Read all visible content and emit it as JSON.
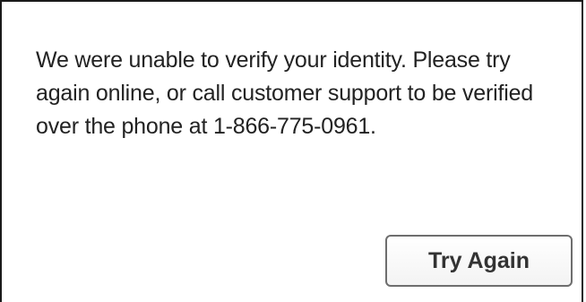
{
  "dialog": {
    "message": "We were unable to verify your identity. Please try again online, or call customer support to be verified over the phone at 1-866-775-0961.",
    "try_again_label": "Try Again"
  }
}
